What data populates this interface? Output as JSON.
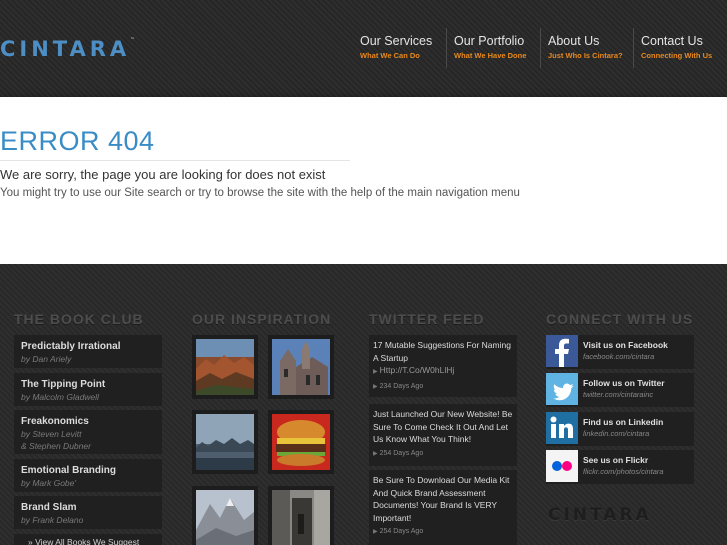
{
  "brand": {
    "name": "CINTARA",
    "tm": "™",
    "color": "#4d8fc4"
  },
  "nav": [
    {
      "label": "Our Services",
      "sub": "What We Can Do"
    },
    {
      "label": "Our Portfolio",
      "sub": "What We Have Done"
    },
    {
      "label": "About Us",
      "sub": "Just Who Is Cintara?"
    },
    {
      "label": "Contact Us",
      "sub": "Connecting With Us"
    }
  ],
  "error": {
    "title": "ERROR 404",
    "sorry": "We are sorry, the page you are looking for does not exist",
    "hint": "You might try to use our Site search or try to browse the site with the help of the main navigation menu"
  },
  "footer": {
    "book_club": {
      "title": "THE BOOK CLUB",
      "books": [
        {
          "title": "Predictably Irrational",
          "author": "by Dan Ariely"
        },
        {
          "title": "The Tipping Point",
          "author": "by Malcolm Gladwell"
        },
        {
          "title": "Freakonomics",
          "author": "by Steven Levitt",
          "author2": "& Stephen Dubner"
        },
        {
          "title": "Emotional Branding",
          "author": "by Mark Gobe'"
        },
        {
          "title": "Brand Slam",
          "author": "by Frank Delano"
        }
      ],
      "view_all": "» View All Books We Suggest"
    },
    "inspiration": {
      "title": "OUR INSPIRATION",
      "thumbs": [
        "canyon-photo",
        "church-photo",
        "city-skyline-photo",
        "burger-photo",
        "mountain-photo",
        "doorway-photo"
      ]
    },
    "twitter": {
      "title": "TWITTER FEED",
      "tweets": [
        {
          "text": "17 Mutable Suggestions For Naming A Startup",
          "link": "Http://T.Co/W0hLlHj",
          "meta": "234 Days Ago"
        },
        {
          "text": "Just Launched Our New Website! Be Sure To Come Check It Out And Let Us Know What You Think!",
          "meta": "254 Days Ago"
        },
        {
          "text": "Be Sure To Download Our Media Kit And Quick Brand Assessment Documents! Your Brand Is VERY Important!",
          "meta": "254 Days Ago"
        }
      ]
    },
    "connect": {
      "title": "CONNECT WITH US",
      "items": [
        {
          "icon": "facebook-icon",
          "title": "Visit us on Facebook",
          "url": "facebook.com/cintara"
        },
        {
          "icon": "twitter-icon",
          "title": "Follow us on Twitter",
          "url": "twitter.com/cintarainc"
        },
        {
          "icon": "linkedin-icon",
          "title": "Find us on Linkedin",
          "url": "linkedin.com/cintara"
        },
        {
          "icon": "flickr-icon",
          "title": "See us on Flickr",
          "url": "flickr.com/photos/cintara"
        }
      ],
      "logo": "CINTARA"
    }
  },
  "colors": {
    "accent_blue": "#3a8cc6",
    "nav_sub_orange": "#e8891c",
    "facebook": "#3b5998",
    "twitter": "#5fb4e4",
    "linkedin": "#1f6fa3"
  }
}
